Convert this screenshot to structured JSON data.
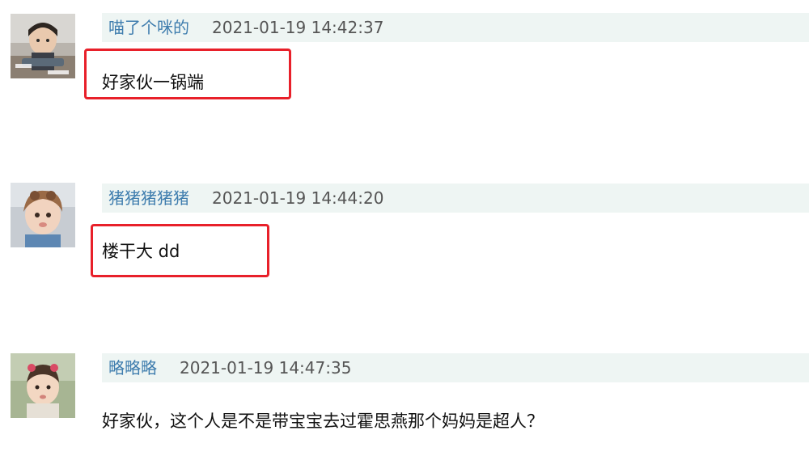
{
  "comments": [
    {
      "username": "喵了个咪的",
      "timestamp": "2021-01-19 14:42:37",
      "text": "好家伙一锅端",
      "highlighted": true,
      "avatar": "avatar-child-1"
    },
    {
      "username": "猪猪猪猪猪",
      "timestamp": "2021-01-19 14:44:20",
      "text": "楼干大 dd",
      "highlighted": true,
      "avatar": "avatar-child-2"
    },
    {
      "username": "略略略",
      "timestamp": "2021-01-19 14:47:35",
      "text": "好家伙，这个人是不是带宝宝去过霍思燕那个妈妈是超人？",
      "highlighted": false,
      "avatar": "avatar-child-3"
    }
  ],
  "colors": {
    "username": "#3f7dae",
    "meta_bar_bg": "#eef5f3",
    "highlight": "#e8202a"
  }
}
